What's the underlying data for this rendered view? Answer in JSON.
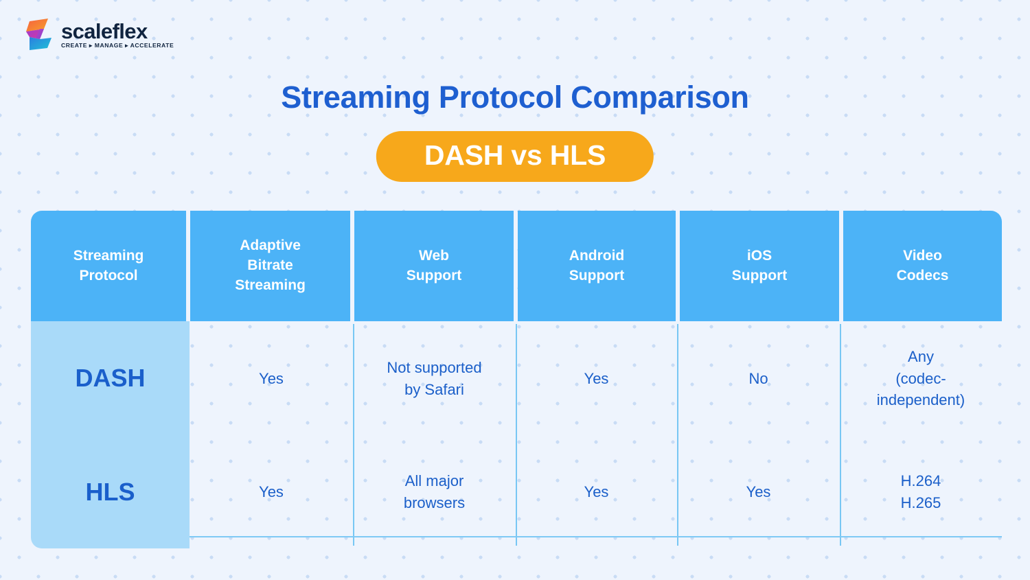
{
  "brand": {
    "logo_icon": "scaleflex-s-logo-icon",
    "wordmark": "scaleflex",
    "tagline": "CREATE ▸ MANAGE ▸ ACCELERATE",
    "logo_colors": [
      "#f7603f",
      "#f59f2c",
      "#b93cc4",
      "#9d3ad0",
      "#2b8fe0",
      "#22c1d6"
    ]
  },
  "header": {
    "title": "Streaming Protocol Comparison",
    "subtitle_badge": "DASH vs HLS",
    "badge_color": "#f7a81b",
    "title_color": "#1e5fd0"
  },
  "table": {
    "header_bg": "#4cb3f7",
    "header_text_color": "#ffffff",
    "protocol_cell_bg": "#a9daf9",
    "cell_text_color": "#1b5fc9",
    "divider_color": "#7ec9f5",
    "columns": [
      "Streaming\nProtocol",
      "Adaptive\nBitrate\nStreaming",
      "Web\nSupport",
      "Android\nSupport",
      "iOS\nSupport",
      "Video\nCodecs"
    ],
    "rows": [
      {
        "protocol": "DASH",
        "adaptive_bitrate_streaming": "Yes",
        "web_support": "Not supported\nby Safari",
        "android_support": "Yes",
        "ios_support": "No",
        "video_codecs": "Any\n(codec-\nindependent)"
      },
      {
        "protocol": "HLS",
        "adaptive_bitrate_streaming": "Yes",
        "web_support": "All major\nbrowsers",
        "android_support": "Yes",
        "ios_support": "Yes",
        "video_codecs": "H.264\nH.265"
      }
    ]
  },
  "background": {
    "color": "#eef4fd",
    "dot_color": "#c8dcf5"
  }
}
